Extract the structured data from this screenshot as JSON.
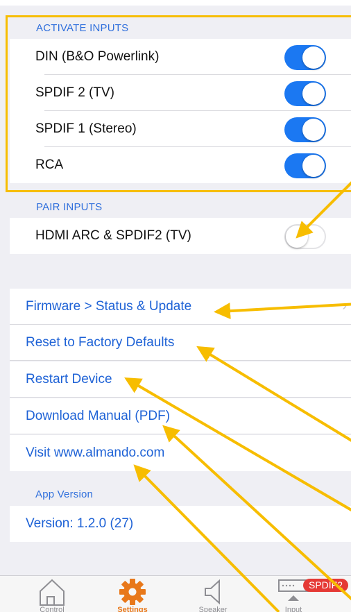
{
  "activate_inputs": {
    "header": "ACTIVATE INPUTS",
    "items": [
      {
        "label": "DIN (B&O Powerlink)",
        "on": true
      },
      {
        "label": "SPDIF 2 (TV)",
        "on": true
      },
      {
        "label": "SPDIF 1 (Stereo)",
        "on": true
      },
      {
        "label": "RCA",
        "on": true
      }
    ]
  },
  "pair_inputs": {
    "header": "PAIR INPUTS",
    "items": [
      {
        "label": "HDMI ARC & SPDIF2 (TV)",
        "on": false
      }
    ]
  },
  "links": {
    "firmware": "Firmware > Status & Update",
    "reset": "Reset to Factory Defaults",
    "restart": "Restart Device",
    "manual": "Download Manual (PDF)",
    "website": "Visit www.almando.com"
  },
  "app_version": {
    "header": "App Version",
    "version": "Version: 1.2.0 (27)"
  },
  "tabbar": {
    "control": "Control",
    "settings": "Settings",
    "speaker": "Speaker",
    "input": "Input",
    "input_badge": "SPDIF2"
  },
  "colors": {
    "toggle_on": "#1b78f2",
    "link": "#1e62d6",
    "highlight": "#f7bd00",
    "active_tab": "#e8781a",
    "badge": "#e53935"
  },
  "icons": {
    "control": "house-icon",
    "settings": "gear-icon",
    "speaker": "speaker-icon",
    "input": "input-icon",
    "firmware_chevron": "chevron-right-icon"
  }
}
